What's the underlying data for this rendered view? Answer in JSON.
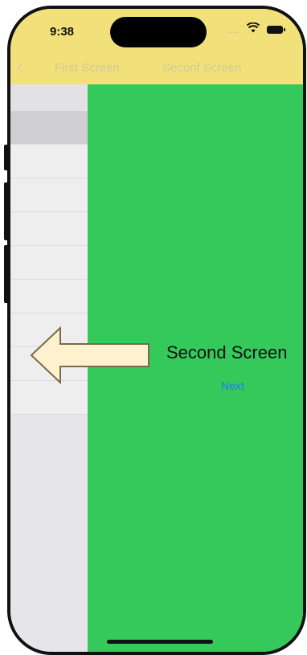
{
  "status": {
    "time": "9:38",
    "signal": "....."
  },
  "nav": {
    "first_tab": "First Screen",
    "second_tab": "Seconf Screen"
  },
  "content": {
    "title": "Second Screen",
    "next_label": "Next"
  },
  "colors": {
    "header": "#f2e17b",
    "content_bg": "#35c85a",
    "link": "#1e7cf2"
  },
  "list_rows": 10
}
